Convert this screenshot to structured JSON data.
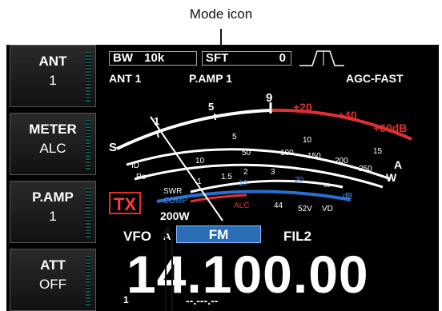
{
  "callout": {
    "label": "Mode icon"
  },
  "side_keys": [
    {
      "title": "ANT",
      "value": "1"
    },
    {
      "title": "METER",
      "value": "ALC"
    },
    {
      "title": "P.AMP",
      "value": "1"
    },
    {
      "title": "ATT",
      "value": "OFF"
    }
  ],
  "top_bar": {
    "bw_label": "BW",
    "bw_value": "10k",
    "sft_label": "SFT",
    "sft_value": "0",
    "ant": "ANT 1",
    "pamp": "P.AMP 1",
    "agc": "AGC-FAST"
  },
  "meter": {
    "s_label": "S",
    "s_scale": [
      "1",
      "5",
      "9"
    ],
    "plus_scale": [
      "+20",
      "+40",
      "+60dB"
    ],
    "id_label": "ID",
    "id_scale": [
      "5",
      "10",
      "15"
    ],
    "a_label": "A",
    "po_label": "Po",
    "po_scale": [
      "10",
      "50",
      "100",
      "150",
      "200",
      "250"
    ],
    "w_label": "W",
    "swr_label": "SWR",
    "swr_scale": [
      "1",
      "1.5",
      "2",
      "3",
      "∞"
    ],
    "comp_label": "COMP",
    "comp_scale": [
      "10",
      "20"
    ],
    "db_label": "dB",
    "alc_label": "ALC",
    "vd_scale": [
      "44",
      "52V"
    ],
    "vd_label": "VD",
    "s_color": "#ffffff",
    "plus_color": "#e03030",
    "comp_color": "#2a6fd0"
  },
  "status": {
    "tx": "TX",
    "power": "200W",
    "vfo": "VFO",
    "vfo_sub": "A",
    "mode": "FM",
    "filter": "FIL2"
  },
  "frequency": {
    "main": "14.100.00",
    "sub": "--.---.--",
    "prefix": "1"
  }
}
